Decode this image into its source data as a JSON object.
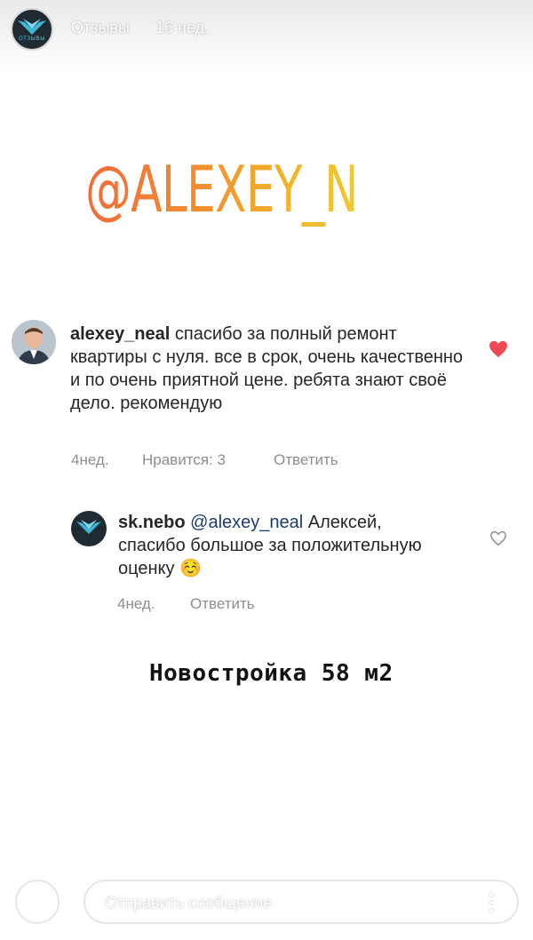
{
  "story": {
    "title": "Отзывы",
    "time": "16 нед.",
    "avatar_label": "ОТЗЫВЫ"
  },
  "sticker": {
    "text": "@ALEXEY_NEAL"
  },
  "comment": {
    "username": "alexey_neal",
    "text": "спасибо за полный ремонт квартиры с нуля. все в срок, очень качественно и по очень приятной цене. ребята знают своё дело. рекомендую",
    "time": "4нед.",
    "likes": "Нравится: 3",
    "reply_label": "Ответить",
    "liked": true
  },
  "reply": {
    "username": "sk.nebo",
    "mention": "@alexey_neal",
    "text": "Алексей, спасибо большое за положительную оценку",
    "emoji": "☺️",
    "time": "4нед.",
    "reply_label": "Ответить",
    "liked": false
  },
  "caption": "Новостройка 58 м2",
  "reply_bar": {
    "placeholder": "Отправить сообщение"
  },
  "colors": {
    "heart_liked": "#ed4956",
    "mention": "#1c3d6b",
    "meta": "#8e8e8e"
  }
}
